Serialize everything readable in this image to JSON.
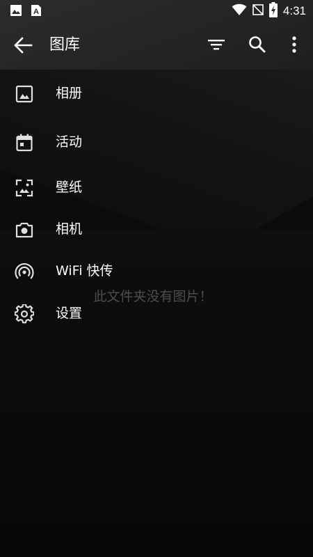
{
  "status_bar": {
    "time": "4:31",
    "icons": [
      "image-icon",
      "text-a-icon",
      "wifi-icon",
      "no-signal-icon",
      "battery-charging-icon"
    ]
  },
  "toolbar": {
    "title": "图库",
    "icons": [
      "back-arrow-icon",
      "filter-icon",
      "search-icon",
      "more-vert-icon"
    ]
  },
  "menu": {
    "items": [
      {
        "label": "相册",
        "icon": "photo-album-icon"
      },
      {
        "label": "活动",
        "icon": "calendar-icon"
      },
      {
        "label": "壁纸",
        "icon": "wallpaper-icon"
      },
      {
        "label": "相机",
        "icon": "camera-icon"
      },
      {
        "label": "WiFi 快传",
        "icon": "wifi-transfer-icon"
      },
      {
        "label": "设置",
        "icon": "settings-gear-icon"
      }
    ]
  },
  "empty_message": "此文件夹没有图片！",
  "colors": {
    "background": "#0b0b0b",
    "toolbar": "#282828",
    "text": "#ffffff",
    "muted_text": "#4d4d4d"
  }
}
